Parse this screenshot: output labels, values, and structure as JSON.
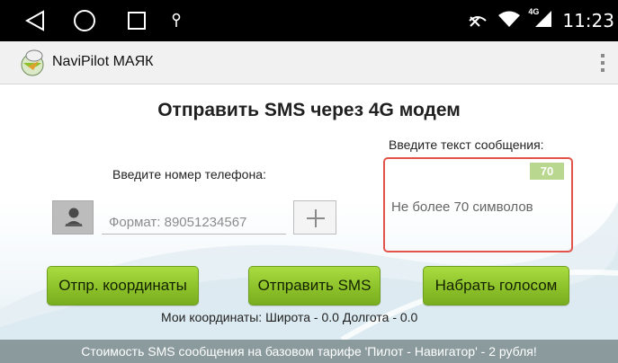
{
  "status_bar": {
    "nav_icons": [
      "back-triangle-icon",
      "home-circle-icon",
      "recents-square-icon",
      "notification-key-icon"
    ],
    "status_icons": [
      "signal-off-icon",
      "wifi-icon",
      "lte-4g-icon"
    ],
    "network_badge": "4G",
    "time": "11:23"
  },
  "app_bar": {
    "title": "NaviPilot МАЯК",
    "logo_icon": "navipilot-logo-icon",
    "overflow_icon": "overflow-menu-icon"
  },
  "main": {
    "page_title": "Отправить SMS через 4G модем",
    "message": {
      "label": "Введите текст сообщения:",
      "counter": "70",
      "placeholder": "Не более 70 символов",
      "border_color": "#e2544a"
    },
    "phone": {
      "label": "Введите номер телефона:",
      "placeholder": "Формат: 89051234567",
      "contact_icon": "contact-person-icon",
      "add_icon": "plus-icon"
    },
    "buttons": {
      "send_coords": "Отпр. координаты",
      "send_sms": "Отправить SMS",
      "voice_call": "Набрать голосом"
    },
    "coords_text": "Мои координаты:  Широта - 0.0  Долгота - 0.0"
  },
  "footer": {
    "text": "Стоимость SMS сообщения на базовом тарифе 'Пилот - Навигатор' - 2 рубля!"
  },
  "colors": {
    "accent_green": "#8dc22b",
    "counter_bg": "#b9d78e",
    "footer_bg": "#8a9a9d",
    "status_bar_bg": "#000000"
  }
}
